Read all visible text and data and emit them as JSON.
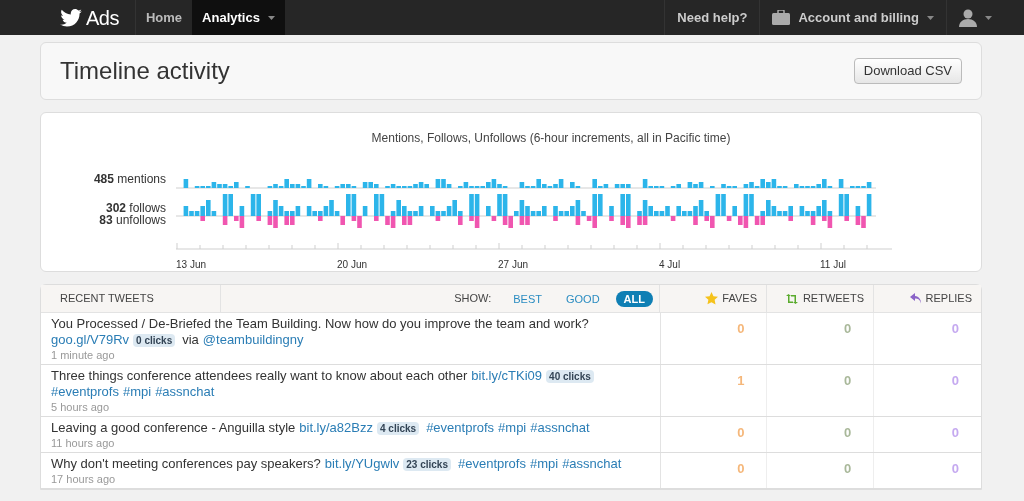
{
  "navbar": {
    "brand": "Ads",
    "items": [
      {
        "label": "Home",
        "selected": false,
        "dropdown": false
      },
      {
        "label": "Analytics",
        "selected": true,
        "dropdown": true
      }
    ],
    "right_items": [
      {
        "kind": "link",
        "label": "Need help?"
      },
      {
        "kind": "account",
        "label": "Account and billing"
      },
      {
        "kind": "user"
      }
    ]
  },
  "header": {
    "title": "Timeline activity",
    "button": "Download CSV"
  },
  "activity": {
    "title": "Mentions, Follows, Unfollows (6-hour increments, all in Pacific time)",
    "legend": [
      "**485** mentions",
      "**302** follows",
      "**83** unfollows"
    ],
    "dates": [
      "13 Jun",
      "20 Jun",
      "27 Jun",
      "4 Jul",
      "11 Jul"
    ]
  },
  "tweets": {
    "heading": "RECENT TWEETS",
    "show_label": "SHOW:",
    "filters": [
      {
        "label": "BEST",
        "selected": false
      },
      {
        "label": "GOOD",
        "selected": false
      },
      {
        "label": "ALL",
        "selected": true
      }
    ],
    "columns": [
      {
        "kind": "faves",
        "label": "FAVES"
      },
      {
        "kind": "retweets",
        "label": "RETWEETS"
      },
      {
        "kind": "replies",
        "label": "REPLIES"
      }
    ],
    "rows": [
      {
        "parts": [
          {
            "kind": "text",
            "text": "You Processed / De-Briefed the Team Building. Now how do you improve the team and work?"
          },
          {
            "kind": "link",
            "text": "goo.gl/V79Rv"
          },
          {
            "kind": "badge",
            "text": "0 clicks"
          },
          {
            "kind": "text",
            "text": "via"
          },
          {
            "kind": "link",
            "text": "@teambuildingny"
          }
        ],
        "time": "1 minute ago",
        "faves": "0",
        "retweets": "0",
        "replies": "0"
      },
      {
        "parts": [
          {
            "kind": "text",
            "text": "Three things conference attendees really want to know about each other"
          },
          {
            "kind": "link",
            "text": "bit.ly/cTKi09"
          },
          {
            "kind": "badge",
            "text": "40 clicks"
          },
          {
            "kind": "link",
            "text": "#eventprofs"
          },
          {
            "kind": "link",
            "text": "#mpi"
          },
          {
            "kind": "link",
            "text": "#assnchat"
          }
        ],
        "time": "5 hours ago",
        "faves": "1",
        "retweets": "0",
        "replies": "0"
      },
      {
        "parts": [
          {
            "kind": "text",
            "text": "Leaving a good conference - Anguilla style"
          },
          {
            "kind": "link",
            "text": "bit.ly/a82Bzz"
          },
          {
            "kind": "badge",
            "text": "4 clicks"
          },
          {
            "kind": "link",
            "text": "#eventprofs"
          },
          {
            "kind": "link",
            "text": "#mpi"
          },
          {
            "kind": "link",
            "text": "#assnchat"
          }
        ],
        "time": "11 hours ago",
        "faves": "0",
        "retweets": "0",
        "replies": "0"
      },
      {
        "parts": [
          {
            "kind": "text",
            "text": "Why don't meeting conferences pay speakers?"
          },
          {
            "kind": "link",
            "text": "bit.ly/YUgwlv"
          },
          {
            "kind": "badge",
            "text": "23 clicks"
          },
          {
            "kind": "link",
            "text": "#eventprofs"
          },
          {
            "kind": "link",
            "text": "#mpi"
          },
          {
            "kind": "link",
            "text": "#assnchat"
          }
        ],
        "time": "17 hours ago",
        "faves": "0",
        "retweets": "0",
        "replies": "0"
      }
    ]
  }
}
